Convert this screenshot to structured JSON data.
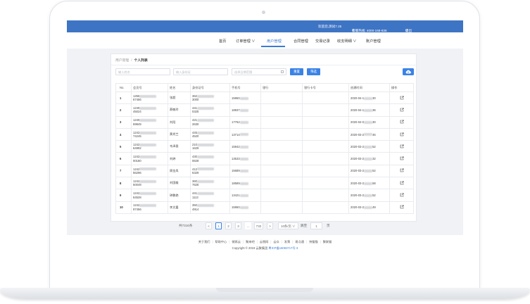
{
  "topbar": {
    "welcome": "欢迎您,测试7.25",
    "hotline": "客服热线: 4000-168-836",
    "logout": "退出"
  },
  "nav": [
    {
      "label": "首页"
    },
    {
      "label": "订单管理 ∨"
    },
    {
      "label": "用户管理"
    },
    {
      "label": "合同管理"
    },
    {
      "label": "交易记录"
    },
    {
      "label": "收支明细 ∨"
    },
    {
      "label": "账户管理"
    }
  ],
  "breadcrumb": {
    "parent": "用户管理",
    "current": "个人列表"
  },
  "filters": {
    "name_placeholder": "输入姓名",
    "id_placeholder": "输入身份证",
    "date_placeholder": "选择日期范围",
    "reset_label": "重置",
    "filter_label": "筛选"
  },
  "columns": [
    "No.",
    "会员号",
    "姓名",
    "身份证号",
    "手机号",
    "银行",
    "银行卡号",
    "创建时间",
    "操作"
  ],
  "rows": [
    {
      "no": "1",
      "member_a": "1256",
      "member_b": "67456",
      "name": "张超",
      "id_a": "362",
      "id_b": "3000",
      "phone": "15950",
      "bank": "",
      "card": "",
      "time_a": "2020-04-1",
      "time_b": "30"
    },
    {
      "no": "2",
      "member_a": "1249",
      "member_b": "45024",
      "name": "蔡敏玲",
      "id_a": "441",
      "id_b": "0325",
      "phone": "18937",
      "bank": "",
      "card": "",
      "time_a": "2020-04-1",
      "time_b": "36"
    },
    {
      "no": "3",
      "member_a": "1249",
      "member_b": "59849",
      "name": "刘阳",
      "id_a": "421",
      "id_b": "2630",
      "phone": "17762",
      "bank": "",
      "card": "",
      "time_a": "2020-04-0",
      "time_b": "30"
    },
    {
      "no": "4",
      "member_a": "1242",
      "member_b": "74245",
      "name": "黄秀兰",
      "id_a": "445",
      "id_b": "4520",
      "phone": "13714",
      "bank": "",
      "card": "",
      "time_a": "2020-03-2",
      "time_b": "46"
    },
    {
      "no": "5",
      "member_a": "1242",
      "member_b": "64992",
      "name": "韦泽昌",
      "id_a": "210",
      "id_b": "1629",
      "phone": "15942",
      "bank": "",
      "card": "",
      "time_a": "2020-03-2",
      "time_b": "52"
    },
    {
      "no": "6",
      "member_a": "1242",
      "member_b": "00180",
      "name": "刘婷",
      "id_a": "430",
      "id_b": "0628",
      "phone": "13533",
      "bank": "",
      "card": "",
      "time_a": "2020-03-2",
      "time_b": "32"
    },
    {
      "no": "7",
      "member_a": "1242",
      "member_b": "56296",
      "name": "周金凤",
      "id_a": "412",
      "id_b": "6329",
      "phone": "15689",
      "bank": "",
      "card": "",
      "time_a": "2020-03-2",
      "time_b": "52"
    },
    {
      "no": "8",
      "member_a": "1242",
      "member_b": "50049",
      "name": "刘国雄",
      "id_a": "360",
      "id_b": "7626",
      "phone": "18589",
      "bank": "",
      "card": "",
      "time_a": "2020-03-2",
      "time_b": "58"
    },
    {
      "no": "9",
      "member_a": "1242",
      "member_b": "64528",
      "name": "钟鹏艳",
      "id_a": "441",
      "id_b": "1113",
      "phone": "13421",
      "bank": "",
      "card": "",
      "time_a": "2020-03-2",
      "time_b": "52"
    },
    {
      "no": "10",
      "member_a": "1242",
      "member_b": "97456",
      "name": "李文嘉",
      "id_a": "350",
      "id_b": "4914",
      "phone": "15950",
      "bank": "",
      "card": "",
      "time_a": "2020-03-2",
      "time_b": "49"
    }
  ],
  "pagination": {
    "total": "共7316条",
    "pages": [
      "1",
      "2",
      "3",
      "…",
      "732"
    ],
    "prev": "<",
    "next": ">",
    "page_size": "10条/页",
    "goto": "跳至",
    "goto_value": "1",
    "page_unit": "页"
  },
  "footer": {
    "links": [
      "关于我们",
      "帮助中心",
      "储易云",
      "聚来吧",
      "云税网",
      "云众",
      "发票",
      "易点通",
      "快猫猫",
      "聚联猫"
    ],
    "copyright": "Copyright © 2019 云聚集团",
    "icp": "粤ICP备16083717号-3"
  },
  "colors": {
    "brand_blue": "#3e74c4",
    "button_blue": "#3b82e6",
    "active_nav": "#3b7ad6"
  }
}
